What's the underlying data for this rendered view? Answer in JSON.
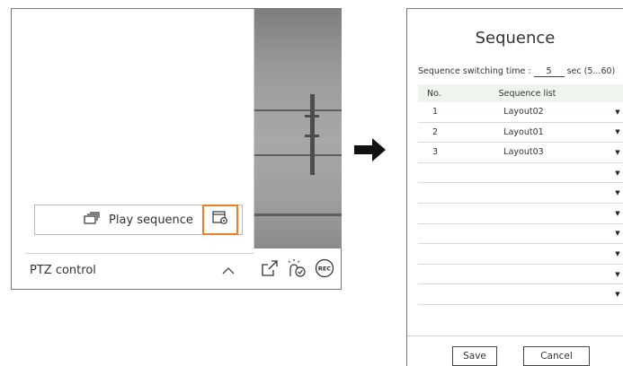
{
  "left_panel": {
    "play_sequence_label": "Play sequence",
    "ptz_label": "PTZ control",
    "rec_label": "REC",
    "highlight_color": "#f07d22"
  },
  "dialog": {
    "title": "Sequence",
    "switch_label": "Sequence switching time :",
    "switch_value": "5",
    "switch_unit": "sec (5...60)",
    "columns": {
      "no": "No.",
      "list": "Sequence list"
    },
    "rows": [
      {
        "no": "1",
        "layout": "Layout02"
      },
      {
        "no": "2",
        "layout": "Layout01"
      },
      {
        "no": "3",
        "layout": "Layout03"
      },
      {
        "no": "",
        "layout": ""
      },
      {
        "no": "",
        "layout": ""
      },
      {
        "no": "",
        "layout": ""
      },
      {
        "no": "",
        "layout": ""
      },
      {
        "no": "",
        "layout": ""
      },
      {
        "no": "",
        "layout": ""
      },
      {
        "no": "",
        "layout": ""
      }
    ],
    "save_label": "Save",
    "cancel_label": "Cancel"
  }
}
